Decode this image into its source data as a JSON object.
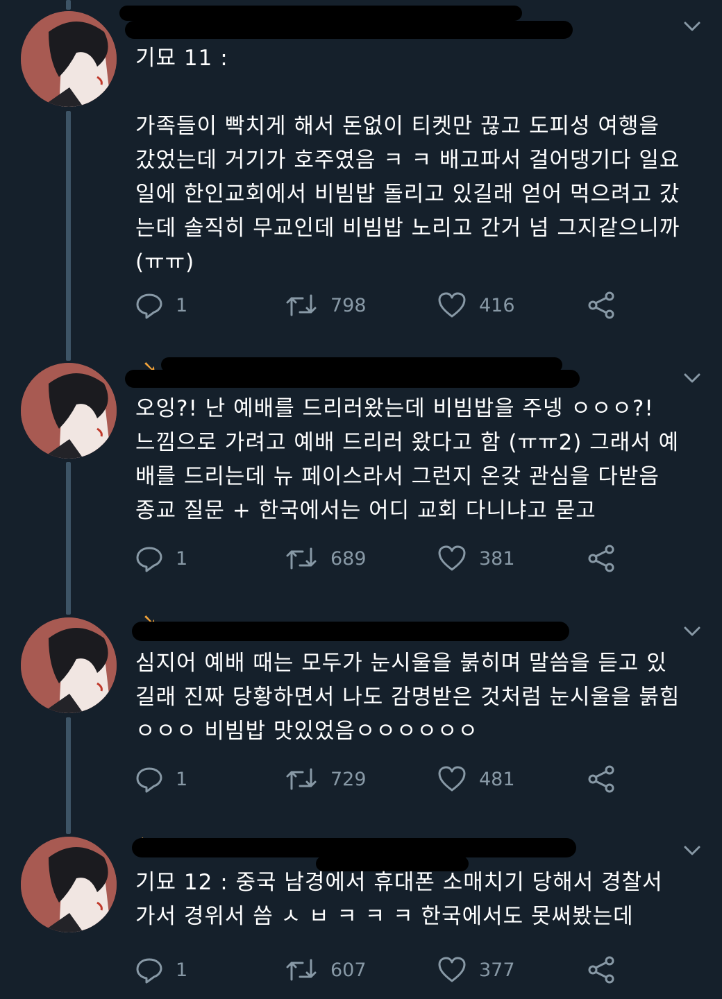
{
  "tweets": [
    {
      "text": "기묘 11 :\n\n가족들이 빡치게 해서 돈없이 티켓만 끊고 도피성 여행을 갔었는데 거기가 호주였음 ㅋ ㅋ 배고파서 걸어댕기다 일요일에 한인교회에서 비빔밥 돌리고 있길래 얻어 먹으려고 갔는데 솔직히 무교인데 비빔밥 노리고 간거 넘 그지같으니까 (ㅠㅠ)",
      "reply_count": "1",
      "retweet_count": "798",
      "like_count": "416"
    },
    {
      "text": "오잉?! 난 예배를 드리러왔는데 비빔밥을 주넹 ㅇㅇㅇ?! 느낌으로 가려고 예배 드리러 왔다고 함 (ㅠㅠ2) 그래서 예배를 드리는데 뉴 페이스라서 그런지 온갖 관심을 다받음 종교 질문 + 한국에서는 어디 교회 다니냐고 묻고",
      "reply_count": "1",
      "retweet_count": "689",
      "like_count": "381"
    },
    {
      "text": "심지어 예배 때는 모두가 눈시울을 붉히며 말씀을 듣고 있길래 진짜 당황하면서 나도 감명받은 것처럼 눈시울을 붉힘ㅇㅇㅇ 비빔밥 맛있었음ㅇㅇㅇㅇㅇㅇ",
      "reply_count": "1",
      "retweet_count": "729",
      "like_count": "481"
    },
    {
      "text": "기묘 12 : 중국 남경에서 휴대폰 소매치기 당해서 경찰서 가서 경위서 씀 ㅅ ㅂ ㅋ ㅋ ㅋ 한국에서도 못써봤는데",
      "reply_count": "1",
      "retweet_count": "607",
      "like_count": "377"
    }
  ],
  "icons": {
    "reply": "reply-icon",
    "retweet": "retweet-icon",
    "like": "heart-icon",
    "share": "share-icon",
    "more": "chevron-down-icon"
  },
  "colors": {
    "background": "#15202b",
    "thread_line": "#3d5466",
    "action_gray": "#8899a6",
    "text": "#ffffff"
  }
}
